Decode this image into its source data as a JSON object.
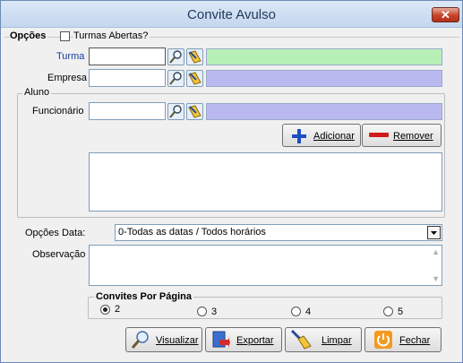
{
  "window": {
    "title": "Convite Avulso",
    "close_glyph": "✕"
  },
  "options": {
    "group_label": "Opções",
    "open_classes_label": "Turmas Abertas?"
  },
  "turma": {
    "label": "Turma",
    "value": "",
    "accent": "#b7f0b6"
  },
  "empresa": {
    "label": "Empresa",
    "value": "",
    "accent": "#b9b9f0"
  },
  "aluno": {
    "group_label": "Aluno",
    "funcionario_label": "Funcionário",
    "funcionario_value": "",
    "accent": "#b9b9f0",
    "add_label": "Adicionar",
    "remove_label": "Remover"
  },
  "date_options": {
    "label": "Opções Data:",
    "selected": "0-Todas as datas / Todos horários"
  },
  "observacao": {
    "label": "Observação",
    "value": ""
  },
  "per_page": {
    "group_label": "Convites Por Página",
    "options": [
      "2",
      "3",
      "4",
      "5"
    ],
    "selected": "2"
  },
  "footer": {
    "view_label": "Visualizar",
    "export_label": "Exportar",
    "clear_label": "Limpar",
    "close_label": "Fechar"
  },
  "icons": [
    "search-icon",
    "broom-icon",
    "plus-icon",
    "minus-icon",
    "magnifier-icon",
    "export-icon",
    "power-icon"
  ]
}
